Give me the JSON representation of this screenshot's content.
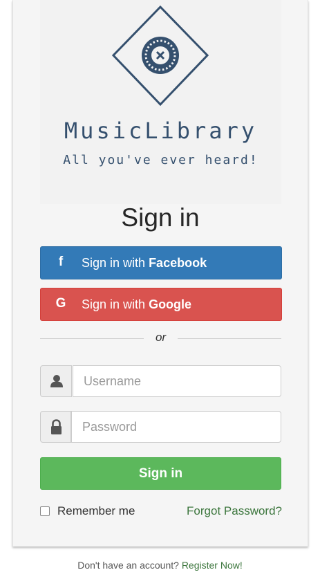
{
  "logo": {
    "title": "MusicLibrary",
    "tagline": "All you've ever heard!"
  },
  "heading": "Sign in",
  "social": {
    "facebook": {
      "icon": "f",
      "prefix": "Sign in with ",
      "brand": "Facebook",
      "color": "#337ab7"
    },
    "google": {
      "icon": "G",
      "prefix": "Sign in with ",
      "brand": "Google",
      "color": "#d9534f"
    }
  },
  "divider_text": "or",
  "form": {
    "username": {
      "placeholder": "Username",
      "value": "",
      "icon": "user-icon"
    },
    "password": {
      "placeholder": "Password",
      "value": "",
      "icon": "lock-icon"
    },
    "submit_label": "Sign in",
    "submit_color": "#5cb85c",
    "remember_label": "Remember me",
    "remember_checked": false,
    "forgot_label": "Forgot Password?"
  },
  "footer": {
    "prompt": "Don't have an account?",
    "register_label": "Register Now!"
  },
  "colors": {
    "brand": "#35506e",
    "link": "#3c763d"
  }
}
